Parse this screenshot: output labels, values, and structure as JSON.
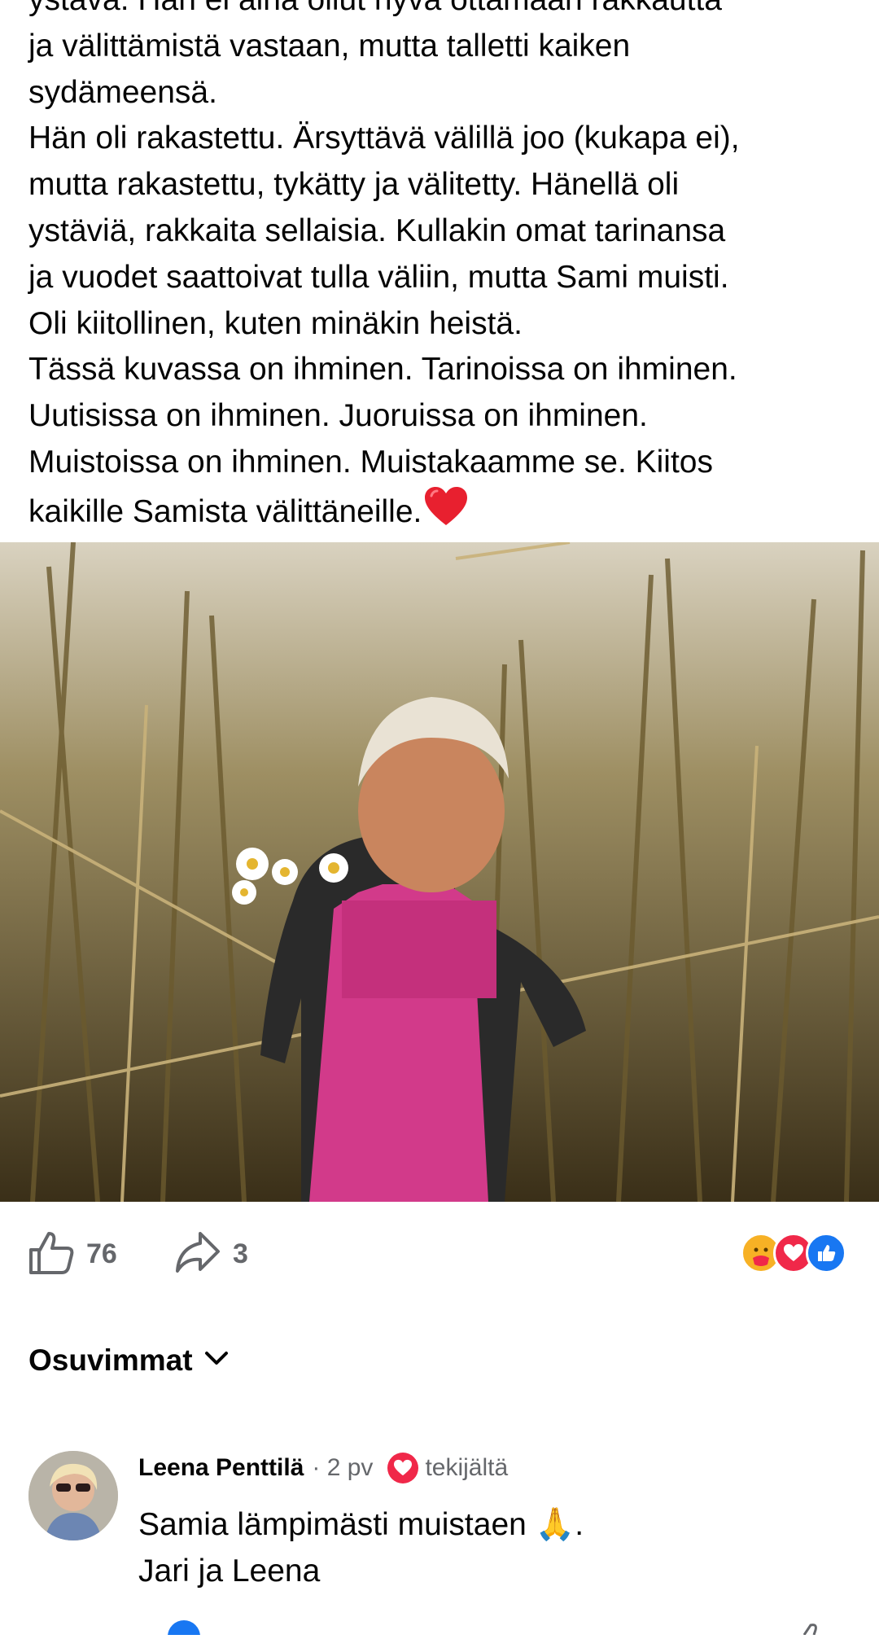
{
  "post": {
    "lines": [
      "ystävä. Hän ei aina ollut hyvä ottamaan rakkautta",
      "ja välittämistä vastaan, mutta talletti kaiken",
      "sydämeensä.",
      "Hän oli rakastettu. Ärsyttävä välillä joo (kukapa ei),",
      "mutta rakastettu, tykätty ja välitetty. Hänellä oli",
      "ystäviä, rakkaita sellaisia. Kullakin omat tarinansa",
      "ja vuodet saattoivat tulla väliin, mutta Sami muisti.",
      "Oli kiitollinen, kuten minäkin heistä.",
      "Tässä kuvassa on ihminen. Tarinoissa on ihminen.",
      "Uutisissa on ihminen. Juoruissa on ihminen.",
      "Muistoissa on ihminen. Muistakaamme se. Kiitos",
      "kaikille Samista välittäneille."
    ],
    "end_emoji": "red-heart-icon"
  },
  "actions": {
    "like_count": "76",
    "share_count": "3",
    "reactions": [
      "care-reaction-icon",
      "love-reaction-icon",
      "like-reaction-icon"
    ]
  },
  "sort": {
    "label": "Osuvimmat"
  },
  "comment": {
    "author": "Leena Penttilä",
    "meta": "· 2 pv",
    "badge": "tekijältä",
    "body_line1": "Samia lämpimästi muistaen",
    "body_emoji": "🙏",
    "body_line1_end": ".",
    "body_line2": "Jari ja Leena"
  },
  "colors": {
    "text": "#050505",
    "secondary": "#65676b",
    "like_blue": "#1877f2",
    "love_red": "#f02849"
  }
}
